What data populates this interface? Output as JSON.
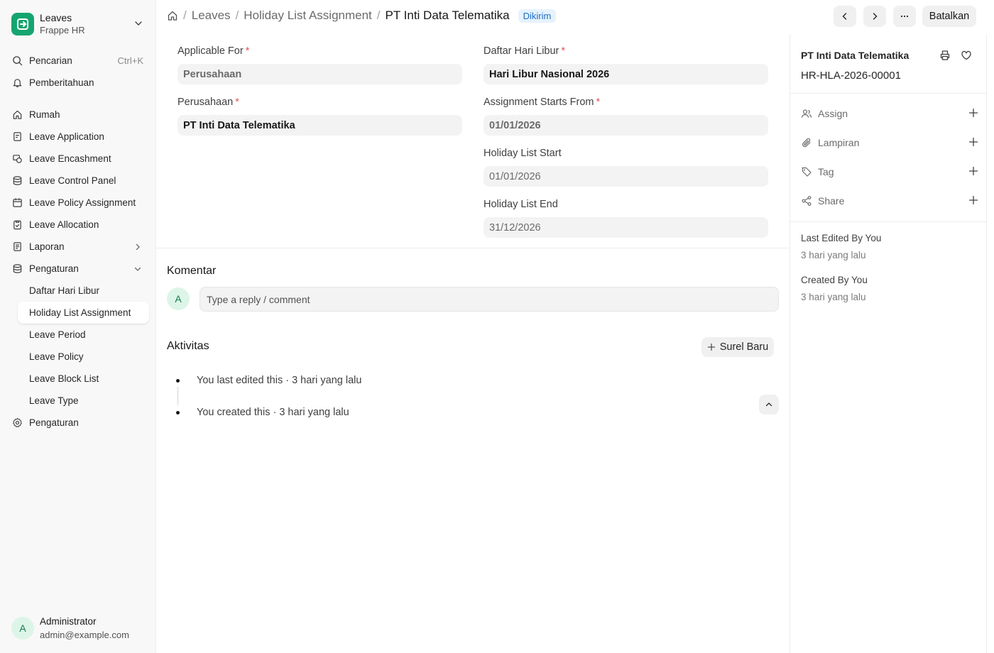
{
  "app": {
    "title": "Leaves",
    "subtitle": "Frappe HR"
  },
  "sidebar": {
    "search_label": "Pencarian",
    "search_shortcut": "Ctrl+K",
    "notifications_label": "Pemberitahuan",
    "items": [
      {
        "label": "Rumah",
        "icon": "home-icon"
      },
      {
        "label": "Leave Application",
        "icon": "leave-application-icon"
      },
      {
        "label": "Leave Encashment",
        "icon": "encashment-icon"
      },
      {
        "label": "Leave Control Panel",
        "icon": "database-icon"
      },
      {
        "label": "Leave Policy Assignment",
        "icon": "calendar-icon"
      },
      {
        "label": "Leave Allocation",
        "icon": "clipboard-icon"
      },
      {
        "label": "Laporan",
        "icon": "report-icon"
      },
      {
        "label": "Pengaturan",
        "icon": "database-icon"
      }
    ],
    "sub_items": [
      "Daftar Hari Libur",
      "Holiday List Assignment",
      "Leave Period",
      "Leave Policy",
      "Leave Block List",
      "Leave Type"
    ],
    "settings_label": "Pengaturan",
    "user": {
      "initial": "A",
      "name": "Administrator",
      "email": "admin@example.com"
    }
  },
  "header": {
    "breadcrumbs": [
      "Leaves",
      "Holiday List Assignment",
      "PT Inti Data Telematika"
    ],
    "status_badge": "Dikirim",
    "cancel_label": "Batalkan"
  },
  "form": {
    "applicable_for": {
      "label": "Applicable For",
      "value": "Perusahaan"
    },
    "company": {
      "label": "Perusahaan",
      "value": "PT Inti Data Telematika"
    },
    "holiday_list": {
      "label": "Daftar Hari Libur",
      "value": "Hari Libur Nasional 2026"
    },
    "assignment_start": {
      "label": "Assignment Starts From",
      "value": "01/01/2026"
    },
    "holiday_list_start": {
      "label": "Holiday List Start",
      "value": "01/01/2026"
    },
    "holiday_list_end": {
      "label": "Holiday List End",
      "value": "31/12/2026"
    }
  },
  "comments": {
    "title": "Komentar",
    "avatar_initial": "A",
    "placeholder": "Type a reply / comment"
  },
  "activity": {
    "title": "Aktivitas",
    "new_email_label": "Surel Baru",
    "items": [
      "You last edited this · 3 hari yang lalu",
      "You created this · 3 hari yang lalu"
    ]
  },
  "right_panel": {
    "title": "PT Inti Data Telematika",
    "doc_id": "HR-HLA-2026-00001",
    "assign_label": "Assign",
    "attachments_label": "Lampiran",
    "tag_label": "Tag",
    "share_label": "Share",
    "last_edited_label": "Last Edited By You",
    "last_edited_value": "3 hari yang lalu",
    "created_label": "Created By You",
    "created_value": "3 hari yang lalu"
  }
}
